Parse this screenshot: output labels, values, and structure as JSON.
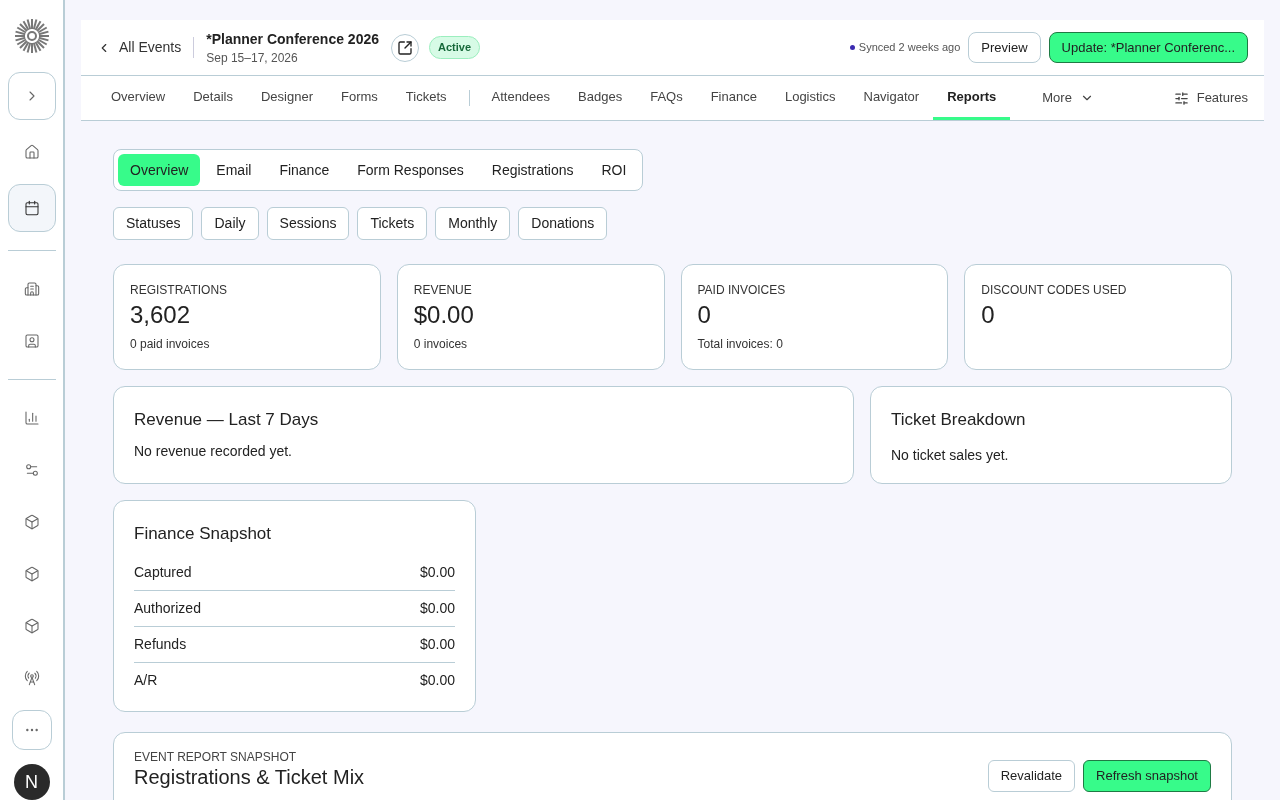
{
  "sidebar": {
    "items": [
      {
        "kind": "expand",
        "selected": false
      },
      {
        "kind": "home",
        "selected": false
      },
      {
        "kind": "calendar",
        "selected": true
      },
      {
        "kind": "divider"
      },
      {
        "kind": "building",
        "selected": false
      },
      {
        "kind": "badge",
        "selected": false
      },
      {
        "kind": "divider"
      },
      {
        "kind": "chart",
        "selected": false
      },
      {
        "kind": "settings",
        "selected": false
      },
      {
        "kind": "box",
        "selected": false
      },
      {
        "kind": "box",
        "selected": false
      },
      {
        "kind": "box",
        "selected": false
      },
      {
        "kind": "antenna",
        "selected": false
      },
      {
        "kind": "more",
        "selected": false
      }
    ],
    "avatar": "N"
  },
  "header": {
    "back": "All Events",
    "title": "*Planner Conference 2026",
    "dates": "Sep 15–17, 2026",
    "status": "Active",
    "sync": "Synced 2 weeks ago",
    "preview": "Preview",
    "update": "Update: *Planner Conferenc..."
  },
  "tabs": [
    {
      "label": "Overview",
      "selected": false
    },
    {
      "label": "Details",
      "selected": false
    },
    {
      "label": "Designer",
      "selected": false
    },
    {
      "label": "Forms",
      "selected": false
    },
    {
      "label": "Tickets",
      "selected": false,
      "divider_after": true
    },
    {
      "label": "Attendees",
      "selected": false
    },
    {
      "label": "Badges",
      "selected": false
    },
    {
      "label": "FAQs",
      "selected": false
    },
    {
      "label": "Finance",
      "selected": false
    },
    {
      "label": "Logistics",
      "selected": false
    },
    {
      "label": "Navigator",
      "selected": false
    },
    {
      "label": "Reports",
      "selected": true
    }
  ],
  "more": "More",
  "features": "Features",
  "report_tabs": [
    {
      "label": "Overview",
      "selected": true
    },
    {
      "label": "Email",
      "selected": false
    },
    {
      "label": "Finance",
      "selected": false
    },
    {
      "label": "Form Responses",
      "selected": false
    },
    {
      "label": "Registrations",
      "selected": false
    },
    {
      "label": "ROI",
      "selected": false
    }
  ],
  "filters": [
    "Statuses",
    "Daily",
    "Sessions",
    "Tickets",
    "Monthly",
    "Donations"
  ],
  "stats": [
    {
      "label": "REGISTRATIONS",
      "value": "3,602",
      "note": "0 paid invoices"
    },
    {
      "label": "REVENUE",
      "value": "$0.00",
      "note": "0 invoices"
    },
    {
      "label": "PAID INVOICES",
      "value": "0",
      "note": "Total invoices: 0"
    },
    {
      "label": "DISCOUNT CODES USED",
      "value": "0"
    }
  ],
  "revenue": {
    "title": "Revenue — Last 7 Days",
    "message": "No revenue recorded yet."
  },
  "tickets": {
    "title": "Ticket Breakdown",
    "message": "No ticket sales yet."
  },
  "finance": {
    "title": "Finance Snapshot",
    "rows": [
      {
        "label": "Captured",
        "value": "$0.00"
      },
      {
        "label": "Authorized",
        "value": "$0.00"
      },
      {
        "label": "Refunds",
        "value": "$0.00"
      },
      {
        "label": "A/R",
        "value": "$0.00"
      }
    ]
  },
  "snapshot": {
    "eyebrow": "EVENT REPORT SNAPSHOT",
    "title": "Registrations & Ticket Mix",
    "revalidate": "Revalidate",
    "refresh": "Refresh snapshot"
  }
}
